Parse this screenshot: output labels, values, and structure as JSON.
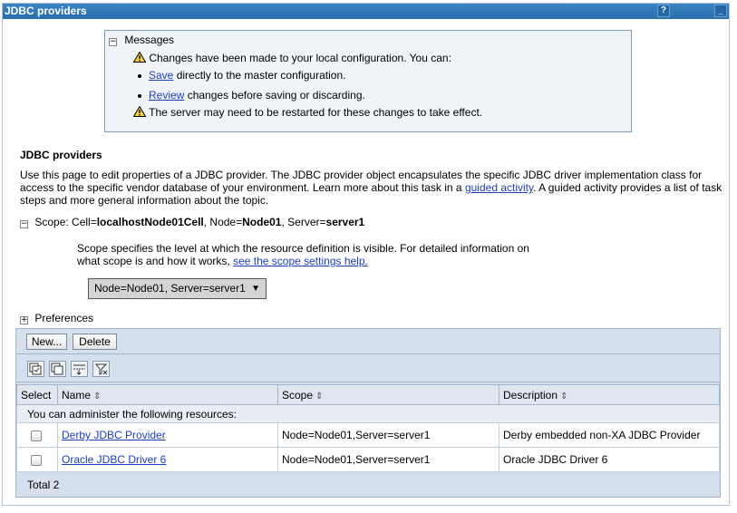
{
  "window": {
    "title": "JDBC providers",
    "help_label": "?",
    "minimize_label": "_"
  },
  "messages": {
    "header": "Messages",
    "line1": "Changes have been made to your local configuration. You can:",
    "save_link": "Save",
    "save_rest": "directly to the master configuration.",
    "review_link": "Review",
    "review_rest": "changes before saving or discarding.",
    "line4": "The server may need to be restarted for these changes to take effect."
  },
  "page": {
    "heading": "JDBC providers",
    "desc_pre": "Use this page to edit properties of a JDBC provider. The JDBC provider object encapsulates the specific JDBC driver implementation class for access to the specific vendor database of your environment. Learn more about this task in a ",
    "desc_link": "guided activity",
    "desc_post": ". A guided activity provides a list of task steps and more general information about the topic."
  },
  "scope": {
    "label": "Scope: Cell=",
    "cell": "localhostNode01Cell",
    "node_label": ", Node=",
    "node": "Node01",
    "server_label": ", Server=",
    "server": "server1",
    "help_text": "Scope specifies the level at which the resource definition is visible. For detailed information on what scope is and how it works, ",
    "help_link": "see the scope settings help.",
    "selected": "Node=Node01, Server=server1"
  },
  "preferences": {
    "label": "Preferences"
  },
  "toolbar": {
    "new_label": "New...",
    "delete_label": "Delete"
  },
  "table": {
    "headers": [
      "Select",
      "Name",
      "Scope",
      "Description"
    ],
    "info": "You can administer the following resources:",
    "rows": [
      {
        "name": "Derby JDBC Provider",
        "scope": "Node=Node01,Server=server1",
        "description": "Derby embedded non-XA JDBC Provider"
      },
      {
        "name": "Oracle JDBC Driver 6",
        "scope": "Node=Node01,Server=server1",
        "description": "Oracle JDBC Driver 6"
      }
    ],
    "total": "Total 2"
  }
}
